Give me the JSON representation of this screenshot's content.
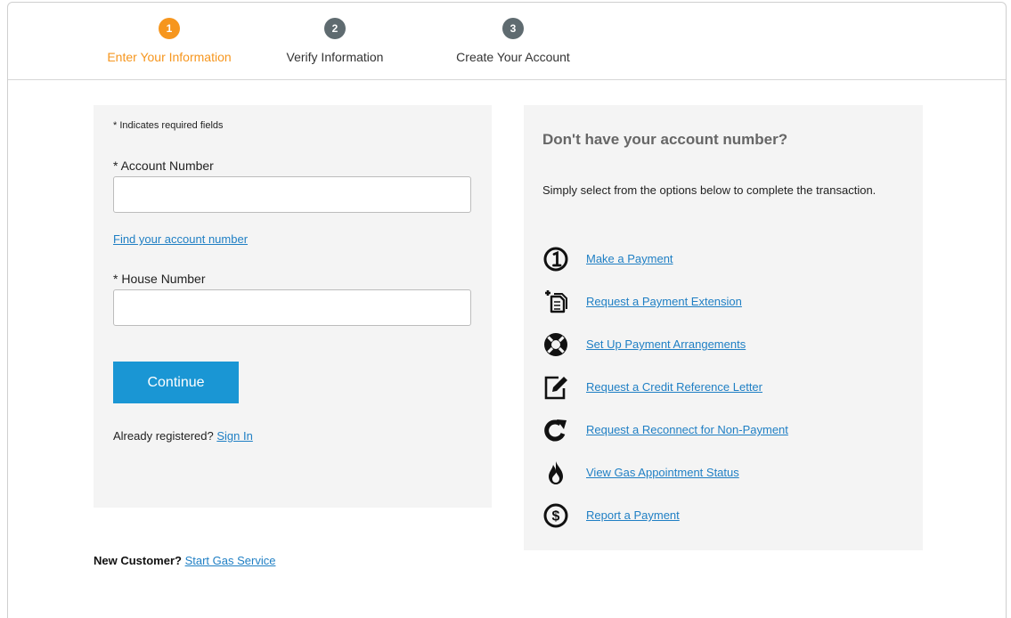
{
  "steps": [
    {
      "number": "1",
      "label": "Enter Your Information",
      "active": true
    },
    {
      "number": "2",
      "label": "Verify Information",
      "active": false
    },
    {
      "number": "3",
      "label": "Create Your Account",
      "active": false
    }
  ],
  "form": {
    "required_note": "* Indicates required fields",
    "account_label": "* Account Number",
    "account_value": "",
    "find_account_link": "Find your account number",
    "house_label": "* House Number",
    "house_value": "",
    "continue_label": "Continue",
    "already_text": "Already registered?",
    "sign_in_link": "Sign In"
  },
  "new_customer": {
    "label": "New Customer?",
    "link": "Start Gas Service"
  },
  "help": {
    "title": "Don't have your account number?",
    "description": "Simply select from the options below to complete the transaction.",
    "options": [
      {
        "icon": "number-one-icon",
        "label": "Make a Payment"
      },
      {
        "icon": "document-plus-icon",
        "label": "Request a Payment Extension"
      },
      {
        "icon": "lifebuoy-icon",
        "label": "Set Up Payment Arrangements"
      },
      {
        "icon": "edit-document-icon",
        "label": "Request a Credit Reference Letter"
      },
      {
        "icon": "reconnect-icon",
        "label": "Request a Reconnect for Non-Payment"
      },
      {
        "icon": "flame-icon",
        "label": "View Gas Appointment Status"
      },
      {
        "icon": "dollar-icon",
        "label": "Report a Payment"
      }
    ]
  },
  "colors": {
    "active_step": "#f6961e",
    "inactive_step": "#5f6b70",
    "button": "#1a96d4",
    "link": "#1f7fc4"
  }
}
